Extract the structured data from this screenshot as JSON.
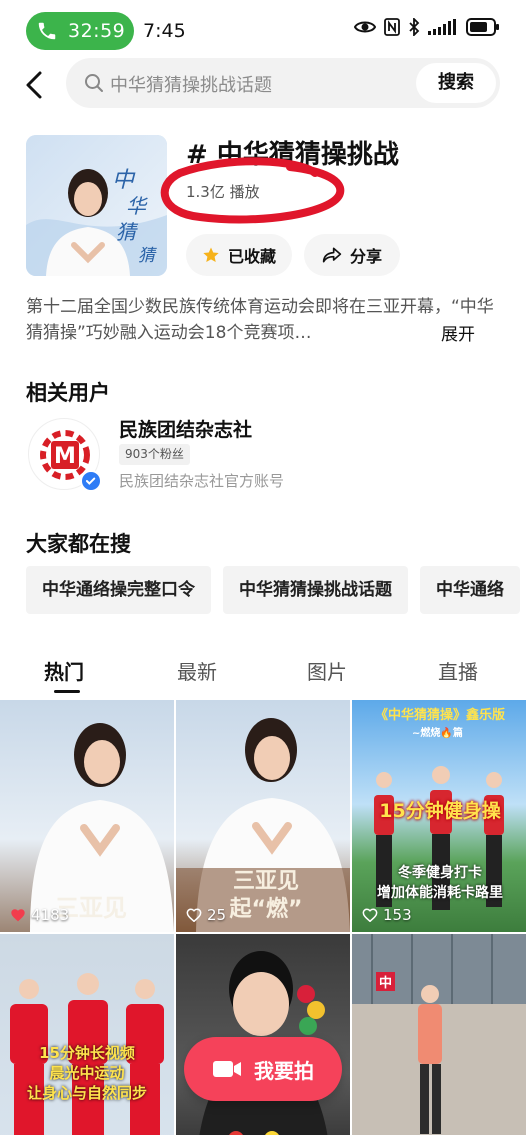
{
  "status_bar": {
    "call_timer": "32:59",
    "clock": "7:45"
  },
  "search": {
    "query": "中华猜猜操挑战话题",
    "button_label": "搜索"
  },
  "topic": {
    "title": "# 中华猜猜操挑战",
    "plays": "1.3亿 播放",
    "favorite_label": "已收藏",
    "share_label": "分享",
    "description": "第十二届全国少数民族传统体育运动会即将在三亚开幕，“中华猜猜操”巧妙融入运动会18个竞赛项…",
    "expand_label": "展开",
    "cover_text": "中华猜猜操"
  },
  "related_users": {
    "title": "相关用户",
    "user": {
      "name": "民族团结杂志社",
      "fans": "903个粉丝",
      "desc": "民族团结杂志社官方账号",
      "avatar_letter": "M"
    }
  },
  "popular_searches": {
    "title": "大家都在搜",
    "chips": [
      "中华通络操完整口令",
      "中华猜猜操挑战话题",
      "中华通络"
    ]
  },
  "tabs": [
    "热门",
    "最新",
    "图片",
    "直播"
  ],
  "videos": [
    {
      "likes": "4183",
      "liked": true,
      "caption": "三亚见"
    },
    {
      "likes": "25",
      "liked": false,
      "caption": "三亚见 起“燃”"
    },
    {
      "likes": "153",
      "liked": false,
      "top_caption": "《中华猜猜操》鑫乐版",
      "sub_caption": "~燃烧🔥篇",
      "caption": "15分钟健身操",
      "caption2": "冬季健身打卡",
      "caption3": "增加体能消耗卡路里"
    },
    {
      "likes": "",
      "caption": "15分钟长视频",
      "caption2": "晨光中运动",
      "caption3": "让身心与自然同步"
    },
    {
      "likes": ""
    },
    {
      "likes": "",
      "caption": "中"
    }
  ],
  "record_button": "我要拍",
  "colors": {
    "accent_red": "#f5425a",
    "call_green": "#3cb44b",
    "verified_blue": "#2e7cf6",
    "annotation_red": "#e0162b"
  }
}
